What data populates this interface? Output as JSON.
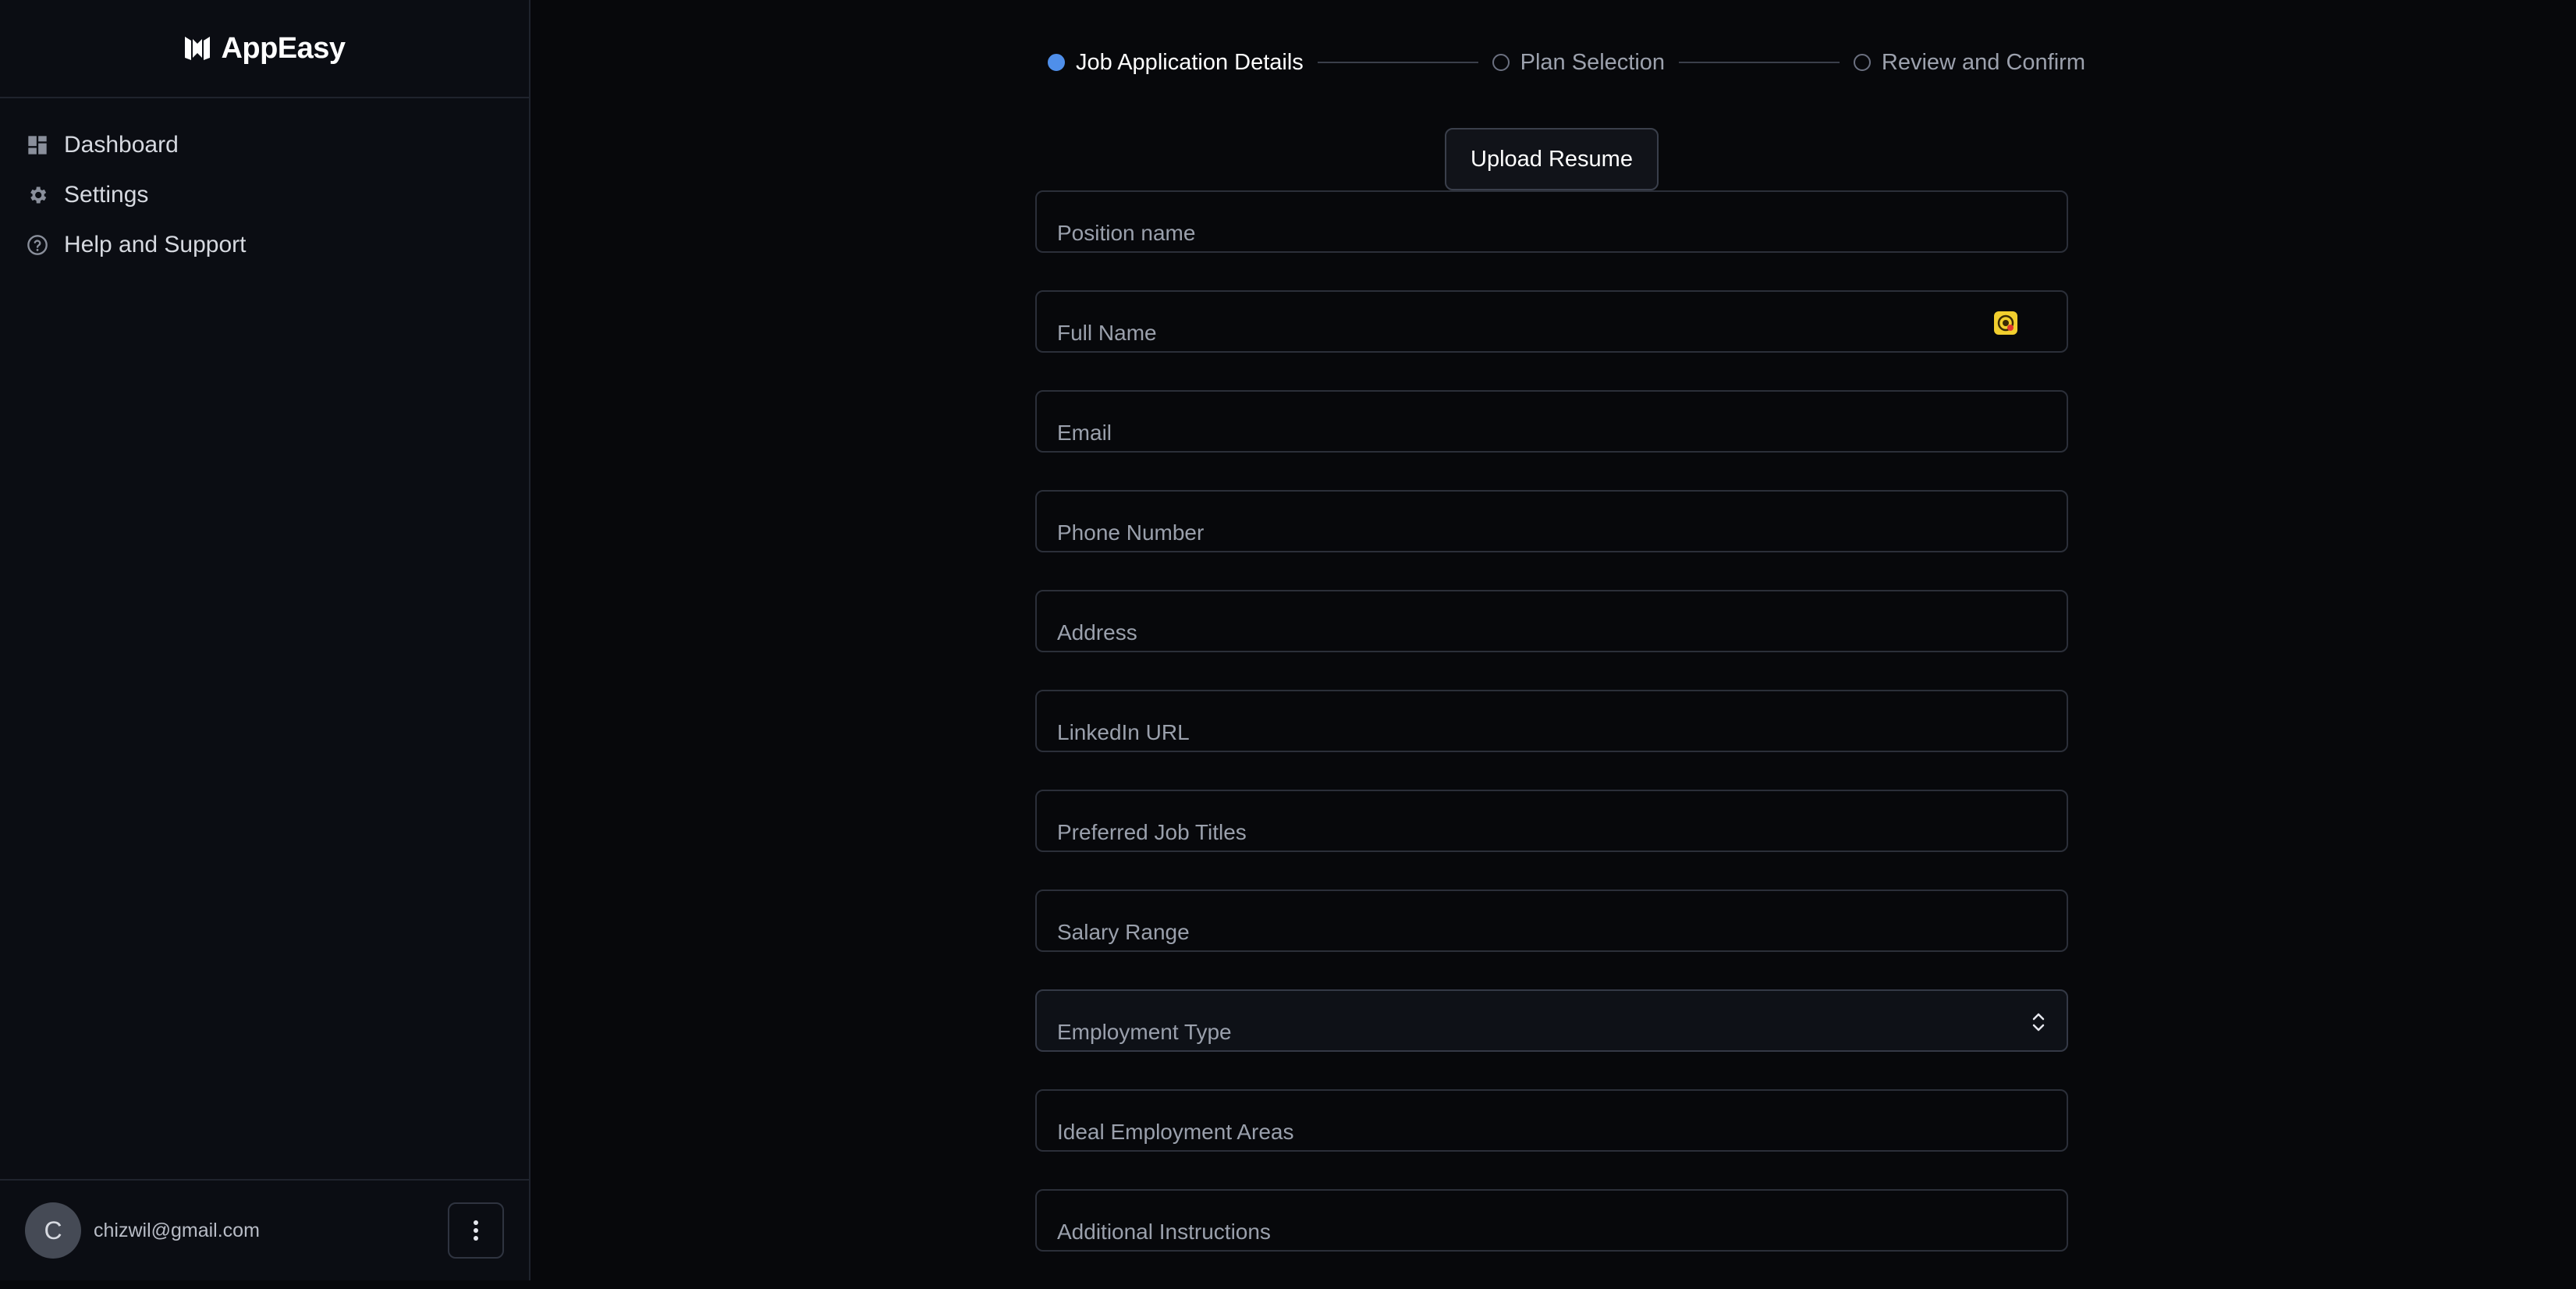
{
  "brand": {
    "name": "AppEasy"
  },
  "sidebar": {
    "items": [
      {
        "label": "Dashboard",
        "icon": "dashboard-icon"
      },
      {
        "label": "Settings",
        "icon": "gear-icon"
      },
      {
        "label": "Help and Support",
        "icon": "help-circle-icon"
      }
    ],
    "user": {
      "avatar_initial": "C",
      "email": "chizwil@gmail.com"
    }
  },
  "stepper": {
    "steps": [
      {
        "label": "Job Application Details",
        "active": true
      },
      {
        "label": "Plan Selection",
        "active": false
      },
      {
        "label": "Review and Confirm",
        "active": false
      }
    ]
  },
  "form": {
    "upload_label": "Upload Resume",
    "fields": {
      "position": {
        "placeholder": "Position name",
        "value": ""
      },
      "full_name": {
        "placeholder": "Full Name",
        "value": ""
      },
      "email": {
        "placeholder": "Email",
        "value": ""
      },
      "phone": {
        "placeholder": "Phone Number",
        "value": ""
      },
      "address": {
        "placeholder": "Address",
        "value": ""
      },
      "linkedin": {
        "placeholder": "LinkedIn URL",
        "value": ""
      },
      "job_titles": {
        "placeholder": "Preferred Job Titles",
        "value": ""
      },
      "salary": {
        "placeholder": "Salary Range",
        "value": ""
      },
      "employment_type": {
        "placeholder": "Employment Type",
        "value": ""
      },
      "areas": {
        "placeholder": "Ideal Employment Areas",
        "value": ""
      },
      "instructions": {
        "placeholder": "Additional Instructions",
        "value": ""
      }
    }
  },
  "colors": {
    "accent": "#4f8fea",
    "background": "#07080b",
    "sidebar": "#0b0d13",
    "autofill_badge": "#f2cf2e"
  }
}
